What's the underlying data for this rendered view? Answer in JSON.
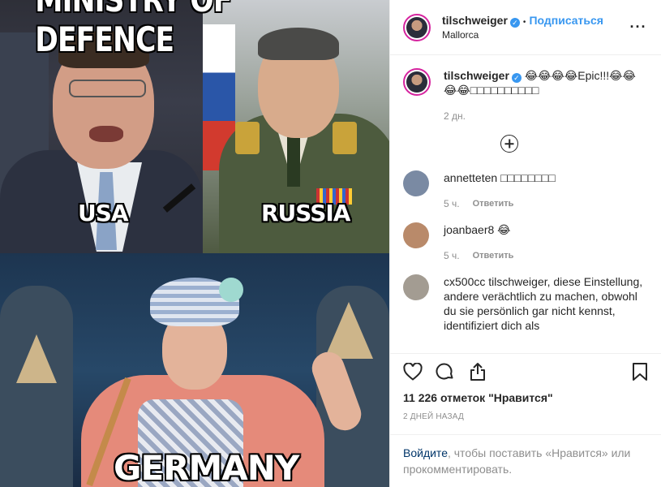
{
  "image": {
    "top_caption": "MINISTRY OF DEFENCE",
    "label_usa": "USA",
    "label_russia": "RUSSIA",
    "label_germany": "GERMANY"
  },
  "header": {
    "username": "tilschweiger",
    "verified_mark": "✓",
    "separator": "•",
    "follow_label": "Подписаться",
    "location": "Mallorca",
    "more_label": "···"
  },
  "caption": {
    "username": "tilschweiger",
    "text": "😂😂😂😂Epic!!!😂😂😂😂□□□□□□□□□□",
    "time": "2 дн."
  },
  "comments": [
    {
      "username": "annetteten",
      "text": "□□□□□□□□",
      "time": "5 ч.",
      "reply": "Ответить",
      "avatar_color": "#7a8aa3"
    },
    {
      "username": "joanbaer8",
      "text": "😂",
      "time": "5 ч.",
      "reply": "Ответить",
      "avatar_color": "#b98a6a"
    },
    {
      "username": "cx500cc",
      "text": "tilschweiger, diese Einstellung, andere verächtlich zu machen, obwohl du sie persönlich gar nicht kennst, identifiziert dich als",
      "time": "",
      "reply": "",
      "avatar_color": "#a39c92"
    }
  ],
  "actions": {
    "like_icon": "heart-icon",
    "comment_icon": "comment-icon",
    "share_icon": "share-icon",
    "save_icon": "bookmark-icon"
  },
  "likes": "11 226 отметок \"Нравится\"",
  "posted_ago": "2 ДНЕЙ НАЗАД",
  "login_prompt": {
    "link": "Войдите",
    "rest": ", чтобы поставить «Нравится» или прокомментировать."
  },
  "colors": {
    "accent": "#3897f0",
    "text": "#262626",
    "muted": "#8e8e8e",
    "border": "#efefef"
  }
}
